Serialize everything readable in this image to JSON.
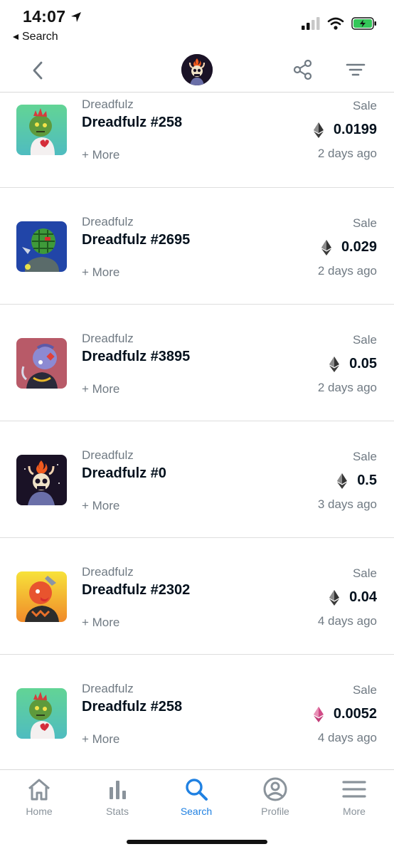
{
  "status_bar": {
    "time": "14:07",
    "back_app": "Search"
  },
  "rows": [
    {
      "collection": "Dreadfulz",
      "title": "Dreadfulz #258",
      "more": "+ More",
      "event": "Sale",
      "price": "0.0199",
      "ago": "2 days ago",
      "currency_icon": "eth-icon",
      "thumb_bg": "#5ccca0"
    },
    {
      "collection": "Dreadfulz",
      "title": "Dreadfulz #2695",
      "more": "+ More",
      "event": "Sale",
      "price": "0.029",
      "ago": "2 days ago",
      "currency_icon": "eth-icon",
      "thumb_bg": "#1f3da0"
    },
    {
      "collection": "Dreadfulz",
      "title": "Dreadfulz #3895",
      "more": "+ More",
      "event": "Sale",
      "price": "0.05",
      "ago": "2 days ago",
      "currency_icon": "eth-icon",
      "thumb_bg": "#b9596a"
    },
    {
      "collection": "Dreadfulz",
      "title": "Dreadfulz #0",
      "more": "+ More",
      "event": "Sale",
      "price": "0.5",
      "ago": "3 days ago",
      "currency_icon": "eth-icon",
      "thumb_bg": "#1a1424"
    },
    {
      "collection": "Dreadfulz",
      "title": "Dreadfulz #2302",
      "more": "+ More",
      "event": "Sale",
      "price": "0.04",
      "ago": "4 days ago",
      "currency_icon": "eth-icon",
      "thumb_bg": "#f5a524"
    },
    {
      "collection": "Dreadfulz",
      "title": "Dreadfulz #258",
      "more": "+ More",
      "event": "Sale",
      "price": "0.0052",
      "ago": "4 days ago",
      "currency_icon": "weth-icon",
      "thumb_bg": "#5ccca0"
    }
  ],
  "tabs": [
    {
      "label": "Home",
      "icon": "home-icon",
      "active": false
    },
    {
      "label": "Stats",
      "icon": "stats-icon",
      "active": false
    },
    {
      "label": "Search",
      "icon": "search-icon",
      "active": true
    },
    {
      "label": "Profile",
      "icon": "profile-icon",
      "active": false
    },
    {
      "label": "More",
      "icon": "menu-icon",
      "active": false
    }
  ],
  "colors": {
    "accent": "#2081e2",
    "secondary_text": "#707a83",
    "primary_text": "#04111d",
    "weth": "#d14b87"
  }
}
